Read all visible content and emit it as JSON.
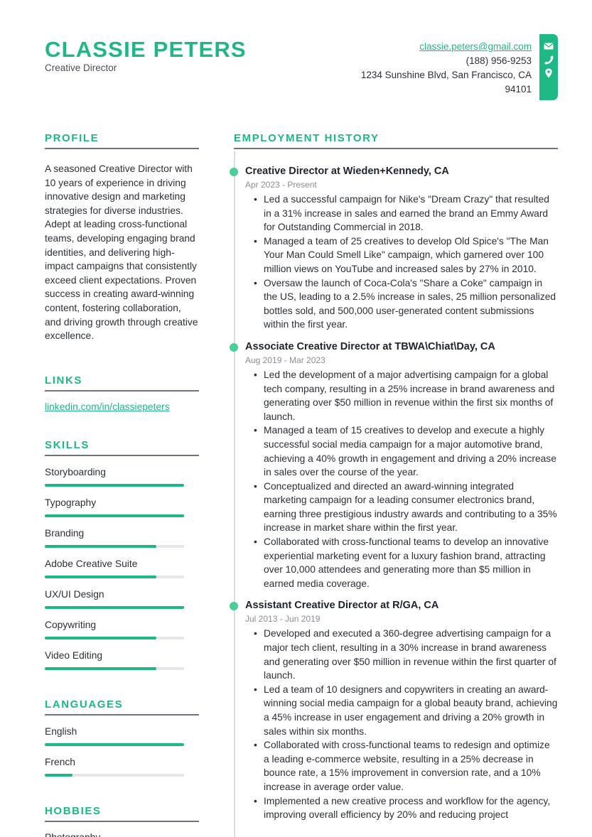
{
  "header": {
    "name": "CLASSIE PETERS",
    "title": "Creative Director"
  },
  "contact": {
    "email": "classie.peters@gmail.com",
    "phone": "(188) 956-9253",
    "address_line1": "1234 Sunshine Blvd, San Francisco, CA",
    "address_line2": "94101",
    "icons": [
      "envelope-icon",
      "phone-icon",
      "map-pin-icon"
    ],
    "accent_color": "#1db883"
  },
  "profile": {
    "heading": "PROFILE",
    "text": "A seasoned Creative Director with 10 years of experience in driving innovative design and marketing strategies for diverse industries. Adept at leading cross-functional teams, developing engaging brand identities, and delivering high-impact campaigns that consistently exceed client expectations. Proven success in creating award-winning content, fostering collaboration, and driving growth through creative excellence."
  },
  "links": {
    "heading": "LINKS",
    "items": [
      {
        "label": "linkedin.com/in/classiepeters"
      }
    ]
  },
  "skills": {
    "heading": "SKILLS",
    "items": [
      {
        "name": "Storyboarding",
        "level": 100
      },
      {
        "name": "Typography",
        "level": 100
      },
      {
        "name": "Branding",
        "level": 80
      },
      {
        "name": "Adobe Creative Suite",
        "level": 80
      },
      {
        "name": "UX/UI Design",
        "level": 100
      },
      {
        "name": "Copywriting",
        "level": 80
      },
      {
        "name": "Video Editing",
        "level": 80
      }
    ]
  },
  "languages": {
    "heading": "LANGUAGES",
    "items": [
      {
        "name": "English",
        "level": 100
      },
      {
        "name": "French",
        "level": 20
      }
    ]
  },
  "hobbies": {
    "heading": "HOBBIES",
    "items": [
      "Photography"
    ]
  },
  "employment": {
    "heading": "EMPLOYMENT HISTORY",
    "jobs": [
      {
        "title": "Creative Director at Wieden+Kennedy, CA",
        "dates": "Apr 2023 - Present",
        "bullets": [
          "Led a successful campaign for Nike's \"Dream Crazy\" that resulted in a 31% increase in sales and earned the brand an Emmy Award for Outstanding Commercial in 2018.",
          "Managed a team of 25 creatives to develop Old Spice's \"The Man Your Man Could Smell Like\" campaign, which garnered over 100 million views on YouTube and increased sales by 27% in 2010.",
          "Oversaw the launch of Coca-Cola's \"Share a Coke\" campaign in the US, leading to a 2.5% increase in sales, 25 million personalized bottles sold, and 500,000 user-generated content submissions within the first year."
        ]
      },
      {
        "title": "Associate Creative Director at TBWA\\Chiat\\Day, CA",
        "dates": "Aug 2019 - Mar 2023",
        "bullets": [
          "Led the development of a major advertising campaign for a global tech company, resulting in a 25% increase in brand awareness and generating over $50 million in revenue within the first six months of launch.",
          "Managed a team of 15 creatives to develop and execute a highly successful social media campaign for a major automotive brand, achieving a 40% growth in engagement and driving a 20% increase in sales over the course of the year.",
          "Conceptualized and directed an award-winning integrated marketing campaign for a leading consumer electronics brand, earning three prestigious industry awards and contributing to a 35% increase in market share within the first year.",
          "Collaborated with cross-functional teams to develop an innovative experiential marketing event for a luxury fashion brand, attracting over 10,000 attendees and generating more than $5 million in earned media coverage."
        ]
      },
      {
        "title": "Assistant Creative Director at R/GA, CA",
        "dates": "Jul 2013 - Jun 2019",
        "bullets": [
          "Developed and executed a 360-degree advertising campaign for a major tech client, resulting in a 30% increase in brand awareness and generating over $50 million in revenue within the first quarter of launch.",
          "Led a team of 10 designers and copywriters in creating an award-winning social media campaign for a global beauty brand, achieving a 45% increase in user engagement and driving a 20% growth in sales within six months.",
          "Collaborated with cross-functional teams to redesign and optimize a leading e-commerce website, resulting in a 25% decrease in bounce rate, a 15% improvement in conversion rate, and a 10% increase in average order value.",
          "Implemented a new creative process and workflow for the agency, improving overall efficiency by 20% and reducing project"
        ]
      }
    ]
  }
}
